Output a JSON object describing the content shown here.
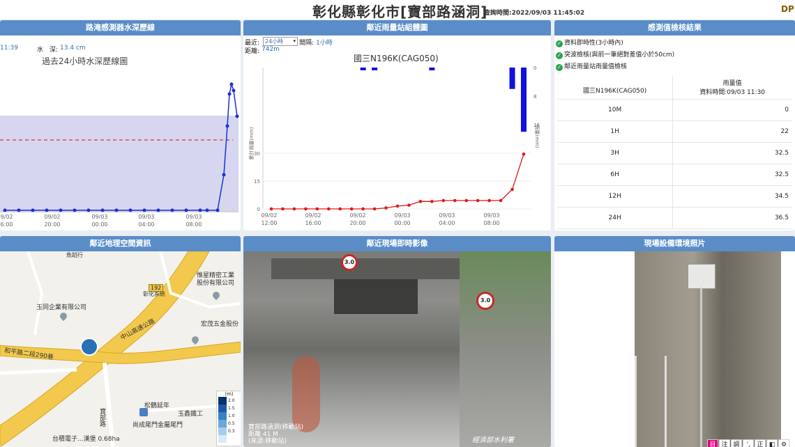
{
  "header": {
    "title": "彰化縣彰化市[寶部路涵洞]",
    "query_time": "查詢時間:2022/09/03 11:45:02",
    "logo": "DP"
  },
  "water": {
    "title": "路淹感測器水深歷線",
    "time_fragment": "11:39",
    "depth_label": "水　深:",
    "depth_value": "13.4 cm",
    "chart_title": "過去24小時水深歷線圖",
    "x_ticks": [
      [
        "09/02",
        "16:00"
      ],
      [
        "09/02",
        "20:00"
      ],
      [
        "09/03",
        "00:00"
      ],
      [
        "09/03",
        "04:00"
      ],
      [
        "09/03",
        "08:00"
      ]
    ]
  },
  "rain": {
    "title": "鄰近雨量站組體圖",
    "recent_label": "最近:",
    "recent_value": "24小時",
    "interval_label": "間隔:",
    "interval_value": "1小時",
    "distance_label": "距離:",
    "distance_value": "742m",
    "station": "國三N196K(CAG050)",
    "left_axis_label": "累計雨量(mm)",
    "right_axis_label": "雨量(mm)",
    "x_ticks": [
      [
        "09/02",
        "12:00"
      ],
      [
        "09/02",
        "16:00"
      ],
      [
        "09/02",
        "20:00"
      ],
      [
        "09/03",
        "00:00"
      ],
      [
        "09/03",
        "04:00"
      ],
      [
        "09/03",
        "08:00"
      ]
    ],
    "chart_data": {
      "type": "bar+line",
      "left_ylim": [
        0,
        30
      ],
      "left_ticks": [
        "30",
        "15",
        "0"
      ],
      "right_ticks": [
        "0",
        "8",
        "16"
      ],
      "right_ylim": [
        0,
        16
      ],
      "hourly_rain": [
        0,
        0,
        0,
        0,
        0,
        0,
        0,
        0,
        0.3,
        0.2,
        0,
        0,
        0,
        0,
        0.3,
        0,
        0,
        0,
        0,
        0,
        0,
        6,
        18
      ],
      "cumulative": [
        0,
        0,
        0,
        0,
        0,
        0,
        0,
        0,
        0,
        0,
        0.5,
        1.5,
        2,
        4,
        4,
        4.5,
        4.5,
        4.5,
        4.5,
        4.5,
        4.5,
        10.5,
        29.5
      ]
    }
  },
  "check": {
    "title": "感測值檢核結果",
    "items": [
      "資料即時性(3小時內)",
      "突波檢核(與前一筆絕對差值小於50cm)",
      "鄰近雨量站雨量值檢核"
    ],
    "table": {
      "col1": "國三N196K(CAG050)",
      "col2_a": "雨量值",
      "col2_b": "資料時間:09/03 11:30",
      "rows": [
        [
          "10M",
          "0"
        ],
        [
          "1H",
          "22"
        ],
        [
          "3H",
          "32.5"
        ],
        [
          "6H",
          "32.5"
        ],
        [
          "12H",
          "34.5"
        ],
        [
          "24H",
          "36.5"
        ]
      ]
    }
  },
  "map": {
    "title": "鄰近地理空間資訊",
    "labels": {
      "road192": "192",
      "district": "彰化系統",
      "fwy": "中山高速公路",
      "co1": "玉同企業有限公司",
      "co2": "惟星精密工業股份有限公司",
      "co3": "宏茂五金股份",
      "road2": "和平路二段290巷",
      "co4": "松鶴延年",
      "co5": "尚成尾門金屬尾門",
      "co6": "玉鑫鐵工",
      "street": "寶部路",
      "shop": "魚蹈行",
      "bottom": "台積電子...漢堡 0.68ha"
    },
    "legend_unit": "(m)",
    "legend_ticks": [
      "2.0",
      "1.5",
      "1.0",
      "0.5",
      "0.3"
    ],
    "legend_colors": [
      "#08306b",
      "#1c5aa6",
      "#3a7fc6",
      "#6aa7dc",
      "#a6cdea",
      "#d8ebf6"
    ]
  },
  "camera": {
    "title": "鄰近現場即時影像",
    "caption": [
      "寶部路涵洞(移動站)",
      "距離 41 M",
      "(來源:移動站)"
    ],
    "sign1": "3.0",
    "sign2": "3.0",
    "brand": "經濟部水利署"
  },
  "photo": {
    "title": "現場設備環境照片",
    "prev": "‹",
    "toolbar": [
      "目",
      "注",
      "調",
      "ʼ,",
      "正",
      "◧",
      "⚙"
    ]
  }
}
